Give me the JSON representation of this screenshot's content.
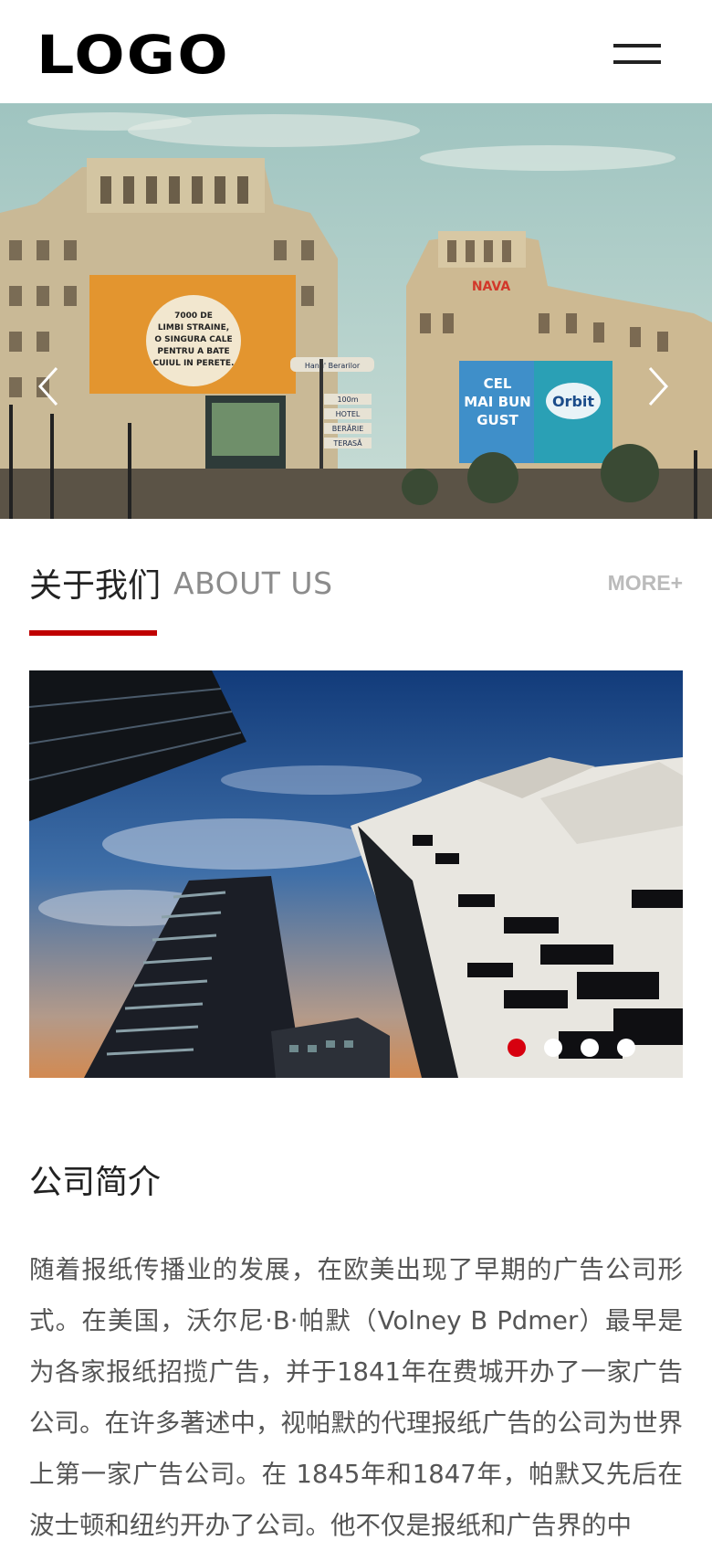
{
  "header": {
    "logo_text": "LOGO",
    "menu_icon": "hamburger-menu-icon"
  },
  "banner": {
    "prev_icon": "chevron-left-icon",
    "next_icon": "chevron-right-icon",
    "billboard_left": [
      "7000 DE",
      "LIMBI STRAINE,",
      "O SINGURA CALE",
      "PENTRU A BATE",
      "CUIUL IN PERETE."
    ],
    "billboard_right": [
      "CEL",
      "MAI BUN",
      "GUST"
    ],
    "billboard_brand": "Orbit",
    "street_signs": [
      "Hanu' Berarilor",
      "100m",
      "HOTEL",
      "BERĂRIE",
      "TERASĂ"
    ],
    "rooftop_sign": "NAVA"
  },
  "about": {
    "title_cn": "关于我们",
    "title_en": "ABOUT US",
    "more_label": "MORE+",
    "accent_color": "#c00000",
    "dots_total": 4,
    "dots_active_index": 0
  },
  "intro": {
    "title": "公司简介",
    "paragraph": "随着报纸传播业的发展，在欧美出现了早期的广告公司形式。在美国，沃尔尼·B·帕默（Volney B Pdmer）最早是为各家报纸招揽广告，并于1841年在费城开办了一家广告公司。在许多著述中，视帕默的代理报纸广告的公司为世界上第一家广告公司。在 1845年和1847年，帕默又先后在波士顿和纽约开办了公司。他不仅是报纸和广告界的中"
  }
}
